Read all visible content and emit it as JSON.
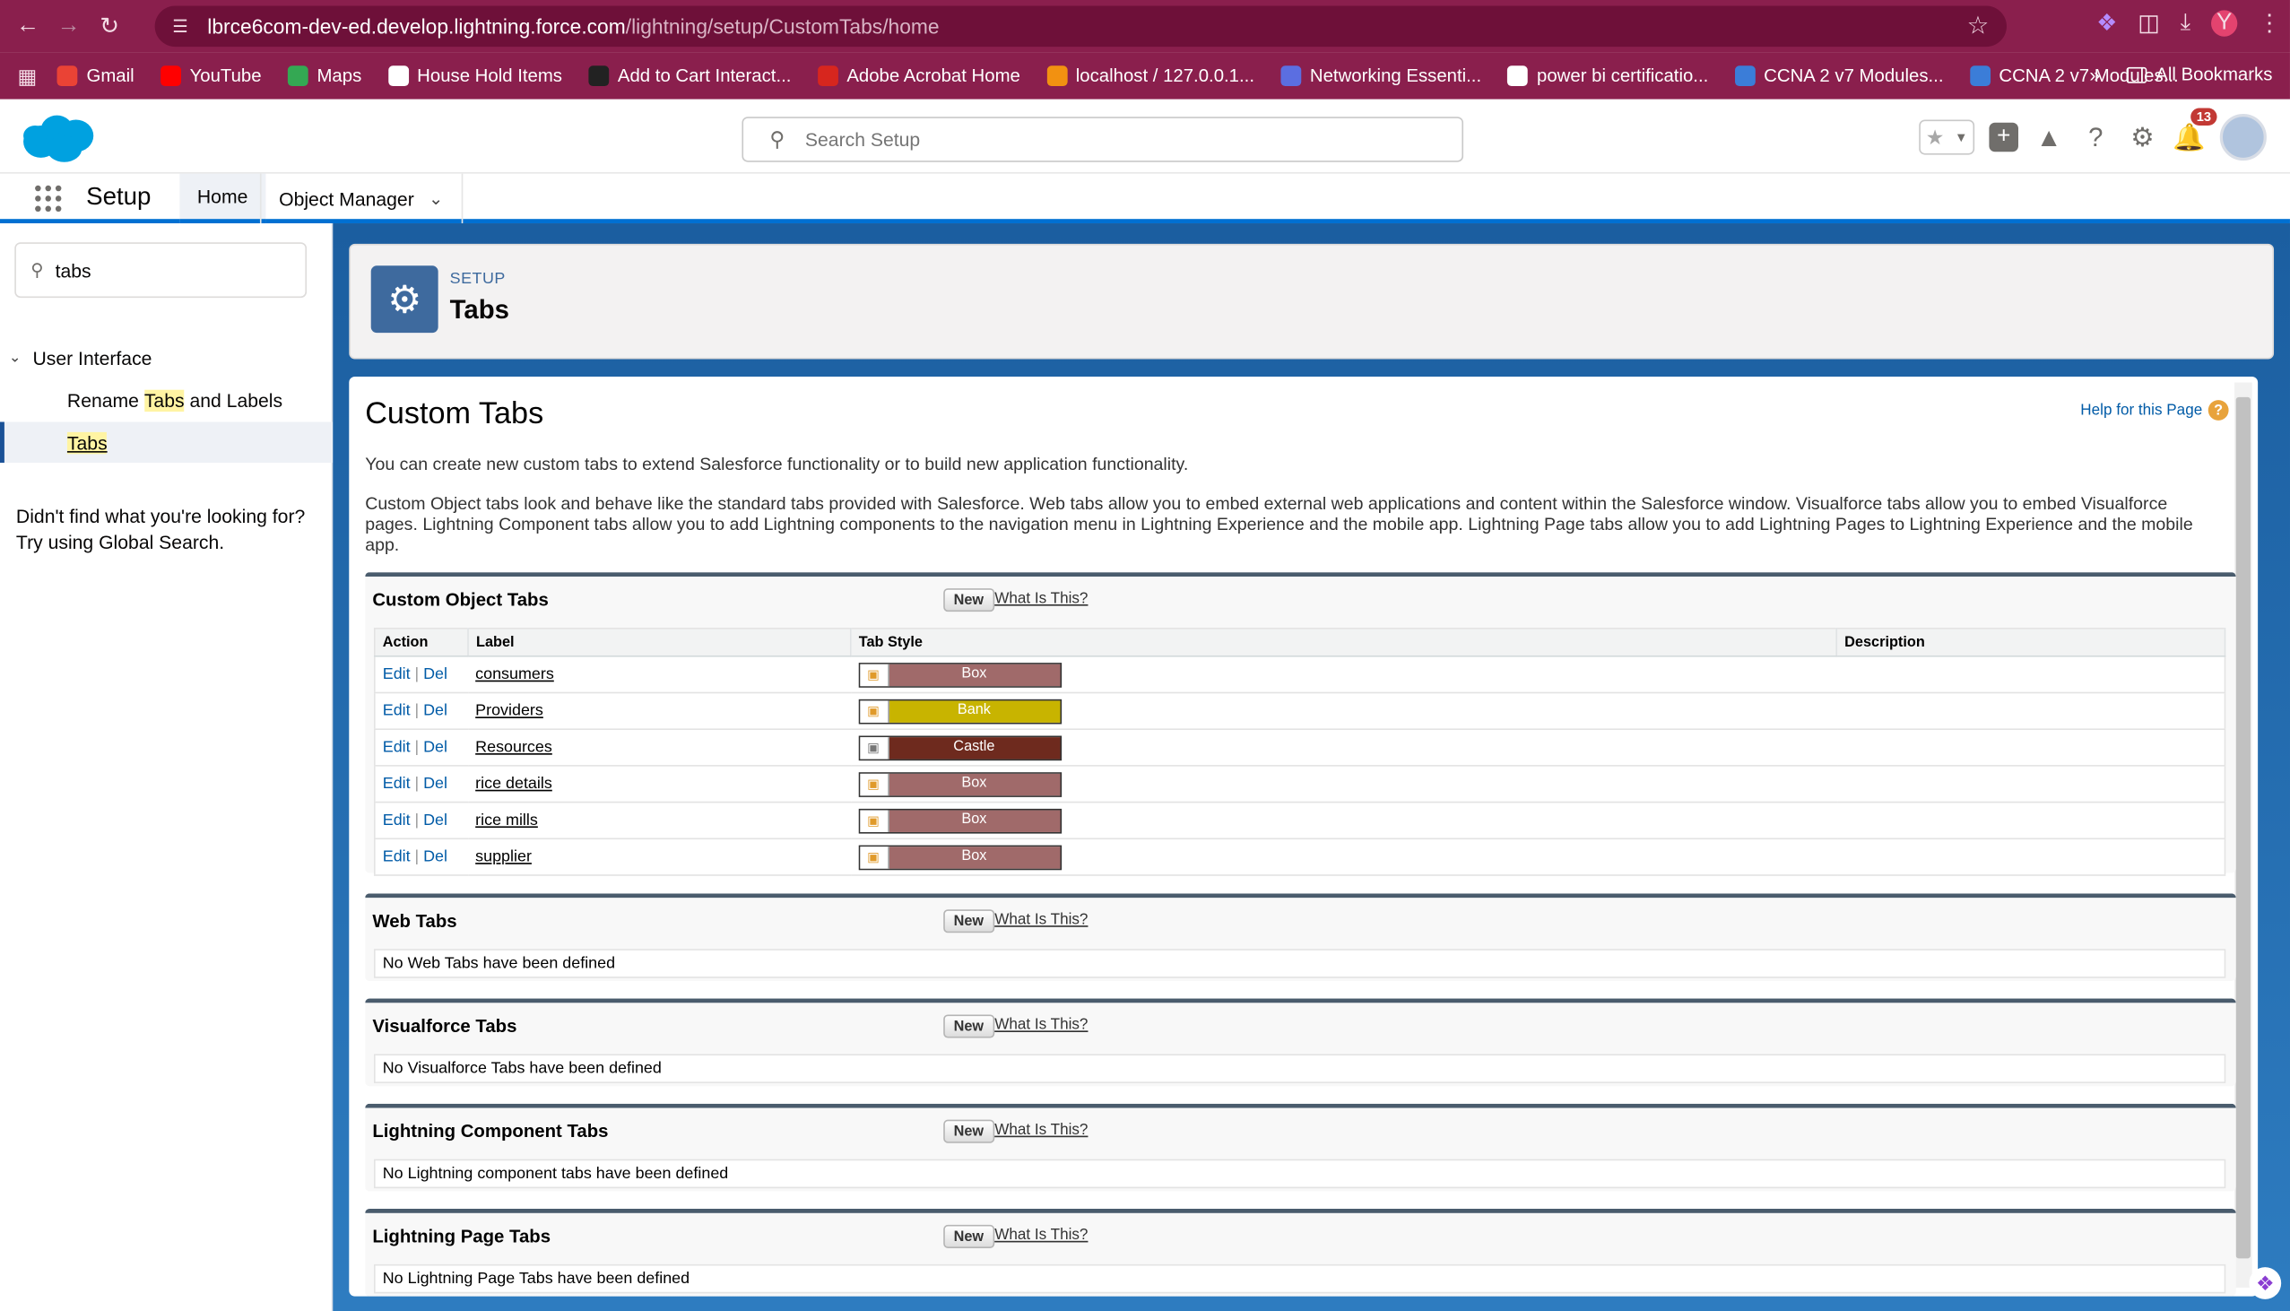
{
  "browser": {
    "url_host": "lbrce6com-dev-ed.develop.lightning.force.com",
    "url_path": "/lightning/setup/CustomTabs/home",
    "profile_initial": "Y",
    "bookmarks": [
      {
        "label": "Gmail",
        "color": "#ea4335"
      },
      {
        "label": "YouTube",
        "color": "#ff0000"
      },
      {
        "label": "Maps",
        "color": "#34a853"
      },
      {
        "label": "House Hold Items",
        "color": "#ffffff"
      },
      {
        "label": "Add to Cart Interact...",
        "color": "#222222"
      },
      {
        "label": "Adobe Acrobat Home",
        "color": "#d7261e"
      },
      {
        "label": "localhost / 127.0.0.1...",
        "color": "#f29111"
      },
      {
        "label": "Networking Essenti...",
        "color": "#5b6ee1"
      },
      {
        "label": "power bi certificatio...",
        "color": "#ffffff"
      },
      {
        "label": "CCNA 2 v7 Modules...",
        "color": "#3b7dd8"
      },
      {
        "label": "CCNA 2 v7 Modules...",
        "color": "#3b7dd8"
      }
    ],
    "more_label": "»",
    "all_bookmarks": "All Bookmarks"
  },
  "header": {
    "search_placeholder": "Search Setup",
    "notification_count": "13"
  },
  "nav": {
    "app_name": "Setup",
    "tabs": [
      {
        "label": "Home"
      },
      {
        "label": "Object Manager"
      }
    ]
  },
  "sidebar": {
    "quick_find_value": "tabs",
    "tree_head": "User Interface",
    "items": [
      {
        "pre": "Rename ",
        "hl": "Tabs",
        "post": " and Labels"
      },
      {
        "pre": "",
        "hl": "Tabs",
        "post": ""
      }
    ],
    "not_found_line1": "Didn't find what you're looking for?",
    "not_found_line2": "Try using Global Search."
  },
  "page_header": {
    "kicker": "SETUP",
    "title": "Tabs"
  },
  "main": {
    "title": "Custom Tabs",
    "help": "Help for this Page",
    "intro1": "You can create new custom tabs to extend Salesforce functionality or to build new application functionality.",
    "intro2": "Custom Object tabs look and behave like the standard tabs provided with Salesforce. Web tabs allow you to embed external web applications and content within the Salesforce window. Visualforce tabs allow you to embed Visualforce pages. Lightning Component tabs allow you to add Lightning components to the navigation menu in Lightning Experience and the mobile app. Lightning Page tabs allow you to add Lightning Pages to Lightning Experience and the mobile app.",
    "new_label": "New",
    "what_label": "What Is This?",
    "edit_label": "Edit",
    "del_label": "Del",
    "custom_object_tabs": {
      "title": "Custom Object Tabs",
      "headers": [
        "Action",
        "Label",
        "Tab Style",
        "Description"
      ],
      "rows": [
        {
          "label": "consumers",
          "style": "Box",
          "color": "#a06a6a"
        },
        {
          "label": "Providers",
          "style": "Bank",
          "color": "#c8b400"
        },
        {
          "label": "Resources",
          "style": "Castle",
          "color": "#6e2a1e"
        },
        {
          "label": "rice details",
          "style": "Box",
          "color": "#a06a6a"
        },
        {
          "label": "rice mills",
          "style": "Box",
          "color": "#a06a6a"
        },
        {
          "label": "supplier",
          "style": "Box",
          "color": "#a06a6a"
        }
      ]
    },
    "web_tabs": {
      "title": "Web Tabs",
      "empty": "No Web Tabs have been defined"
    },
    "visualforce_tabs": {
      "title": "Visualforce Tabs",
      "empty": "No Visualforce Tabs have been defined"
    },
    "lightning_component_tabs": {
      "title": "Lightning Component Tabs",
      "empty": "No Lightning component tabs have been defined"
    },
    "lightning_page_tabs": {
      "title": "Lightning Page Tabs",
      "empty": "No Lightning Page Tabs have been defined"
    }
  }
}
